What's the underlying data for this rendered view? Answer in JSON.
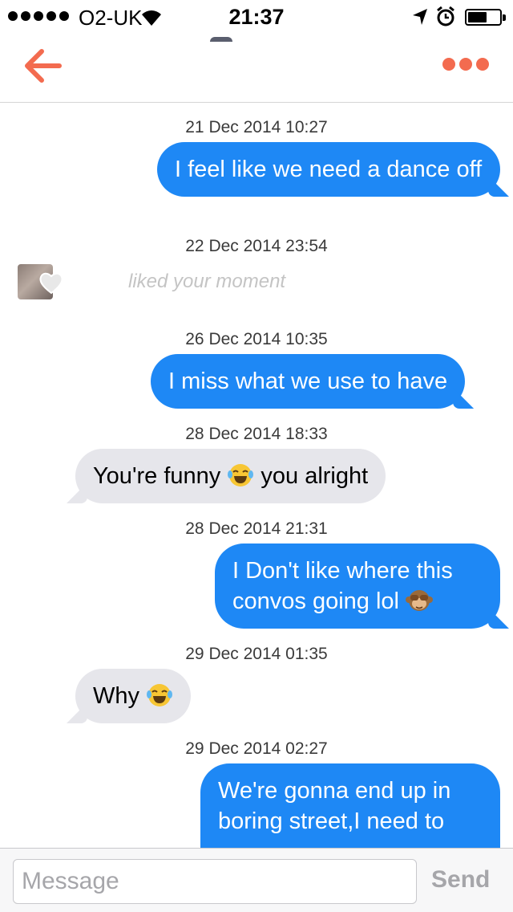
{
  "status_bar": {
    "carrier": "O2-UK",
    "time": "21:37",
    "signal_bars": 5,
    "battery_level": 0.6
  },
  "header": {
    "back_icon": "arrow-left-icon",
    "more_icon": "more-dots-icon",
    "accent_color": "#f36b4f"
  },
  "thread": {
    "timestamps": [
      "21 Dec 2014 10:27",
      "22 Dec 2014 23:54",
      "26 Dec 2014 10:35",
      "28 Dec 2014 18:33",
      "28 Dec 2014 21:31",
      "29 Dec 2014 01:35",
      "29 Dec 2014 02:27"
    ],
    "messages": [
      {
        "from": "me",
        "text": "I feel like we need a dance off"
      },
      {
        "from": "me",
        "text": "I miss what we use to have"
      },
      {
        "from": "them",
        "text_before": "You're funny",
        "emoji": "tears-of-joy-emoji",
        "text_after": "you alright"
      },
      {
        "from": "me",
        "text": "I Don't like where this convos going lol",
        "emoji": "see-no-evil-monkey-emoji"
      },
      {
        "from": "them",
        "text": "Why",
        "emoji": "tears-of-joy-emoji"
      },
      {
        "from": "me",
        "text": "We're gonna end up in boring street,I need to"
      }
    ],
    "moment": {
      "text": "liked your moment",
      "icon": "heart-icon"
    },
    "sent_color": "#1e88f5",
    "received_color": "#e6e6eb"
  },
  "composer": {
    "placeholder": "Message",
    "value": "",
    "send_label": "Send"
  }
}
